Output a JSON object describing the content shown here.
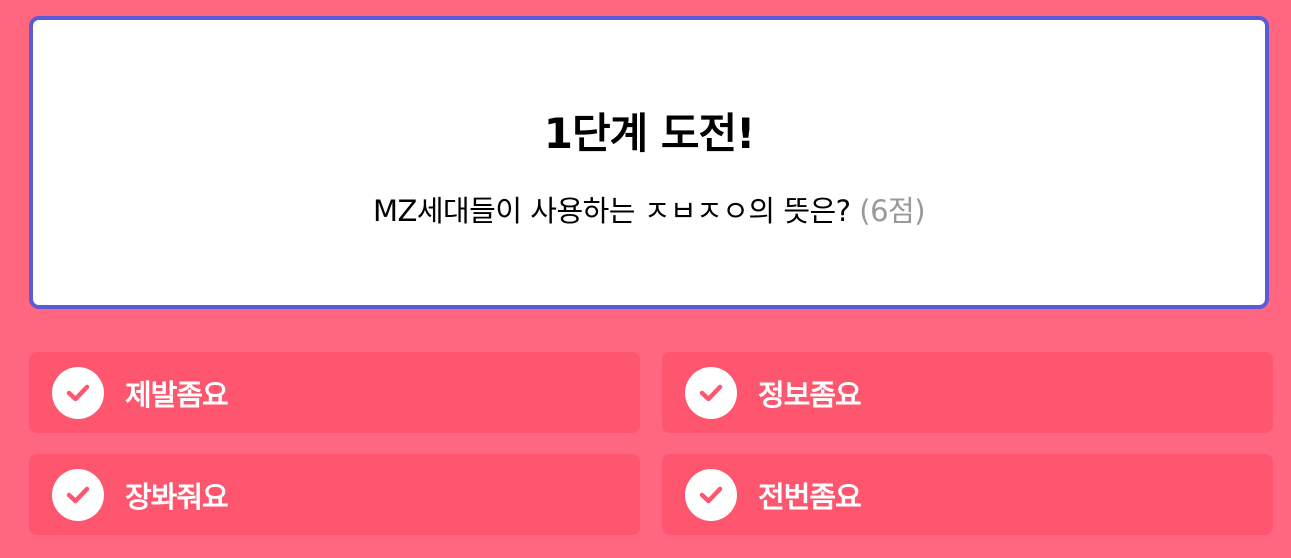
{
  "question": {
    "stage_title": "1단계 도전!",
    "text": "MZ세대들이 사용하는 ㅈㅂㅈㅇ의 뜻은?",
    "points": "(6점)"
  },
  "options": [
    {
      "label": "제발좀요"
    },
    {
      "label": "정보좀요"
    },
    {
      "label": "장봐줘요"
    },
    {
      "label": "전번좀요"
    }
  ],
  "colors": {
    "background": "#ff6780",
    "option_bg": "#ff566f",
    "card_border": "#5b5bd6",
    "check": "#ff566f"
  },
  "icons": {
    "option_icon": "check-circle-icon"
  }
}
